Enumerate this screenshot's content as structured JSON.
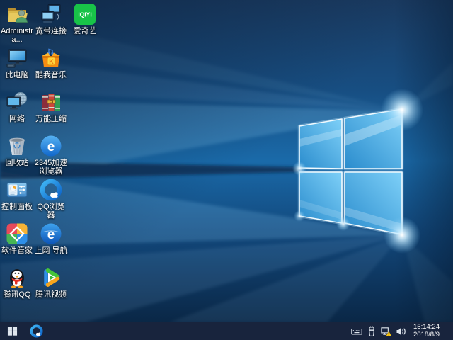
{
  "desktop": {
    "icons": [
      {
        "label": "Administra...",
        "icon": "user-folder-icon"
      },
      {
        "label": "宽带连接",
        "icon": "broadband-connection-icon"
      },
      {
        "label": "爱奇艺",
        "icon": "iqiyi-icon"
      },
      {
        "label": "此电脑",
        "icon": "this-pc-icon"
      },
      {
        "label": "酷我音乐",
        "icon": "kuwo-music-icon"
      },
      {
        "label": "网络",
        "icon": "network-icon"
      },
      {
        "label": "万能压缩",
        "icon": "archiver-books-icon"
      },
      {
        "label": "回收站",
        "icon": "recycle-bin-icon"
      },
      {
        "label": "2345加速浏览器",
        "icon": "2345-browser-icon"
      },
      {
        "label": "控制面板",
        "icon": "control-panel-icon"
      },
      {
        "label": "QQ浏览器",
        "icon": "qq-browser-icon"
      },
      {
        "label": "软件管家",
        "icon": "software-manager-icon"
      },
      {
        "label": "上网 导航",
        "icon": "internet-nav-icon"
      },
      {
        "label": "腾讯QQ",
        "icon": "tencent-qq-icon"
      },
      {
        "label": "腾讯视频",
        "icon": "tencent-video-icon"
      }
    ]
  },
  "taskbar": {
    "start_button": {
      "icon": "windows-start-icon"
    },
    "pinned": [
      {
        "icon": "qq-browser-taskbar-icon"
      }
    ],
    "tray": {
      "icons": [
        "touch-keyboard-icon",
        "usb-device-icon",
        "network-warning-icon",
        "volume-icon"
      ],
      "time": "15:14:24",
      "date": "2018/8/9"
    }
  },
  "colors": {
    "taskbar_bg": "#18243d",
    "label_text": "#ffffff",
    "wallpaper_mid_blue": "#1a6aa9",
    "logo_pane_light": "#7ed0f8",
    "warning_yellow": "#f8c514"
  }
}
